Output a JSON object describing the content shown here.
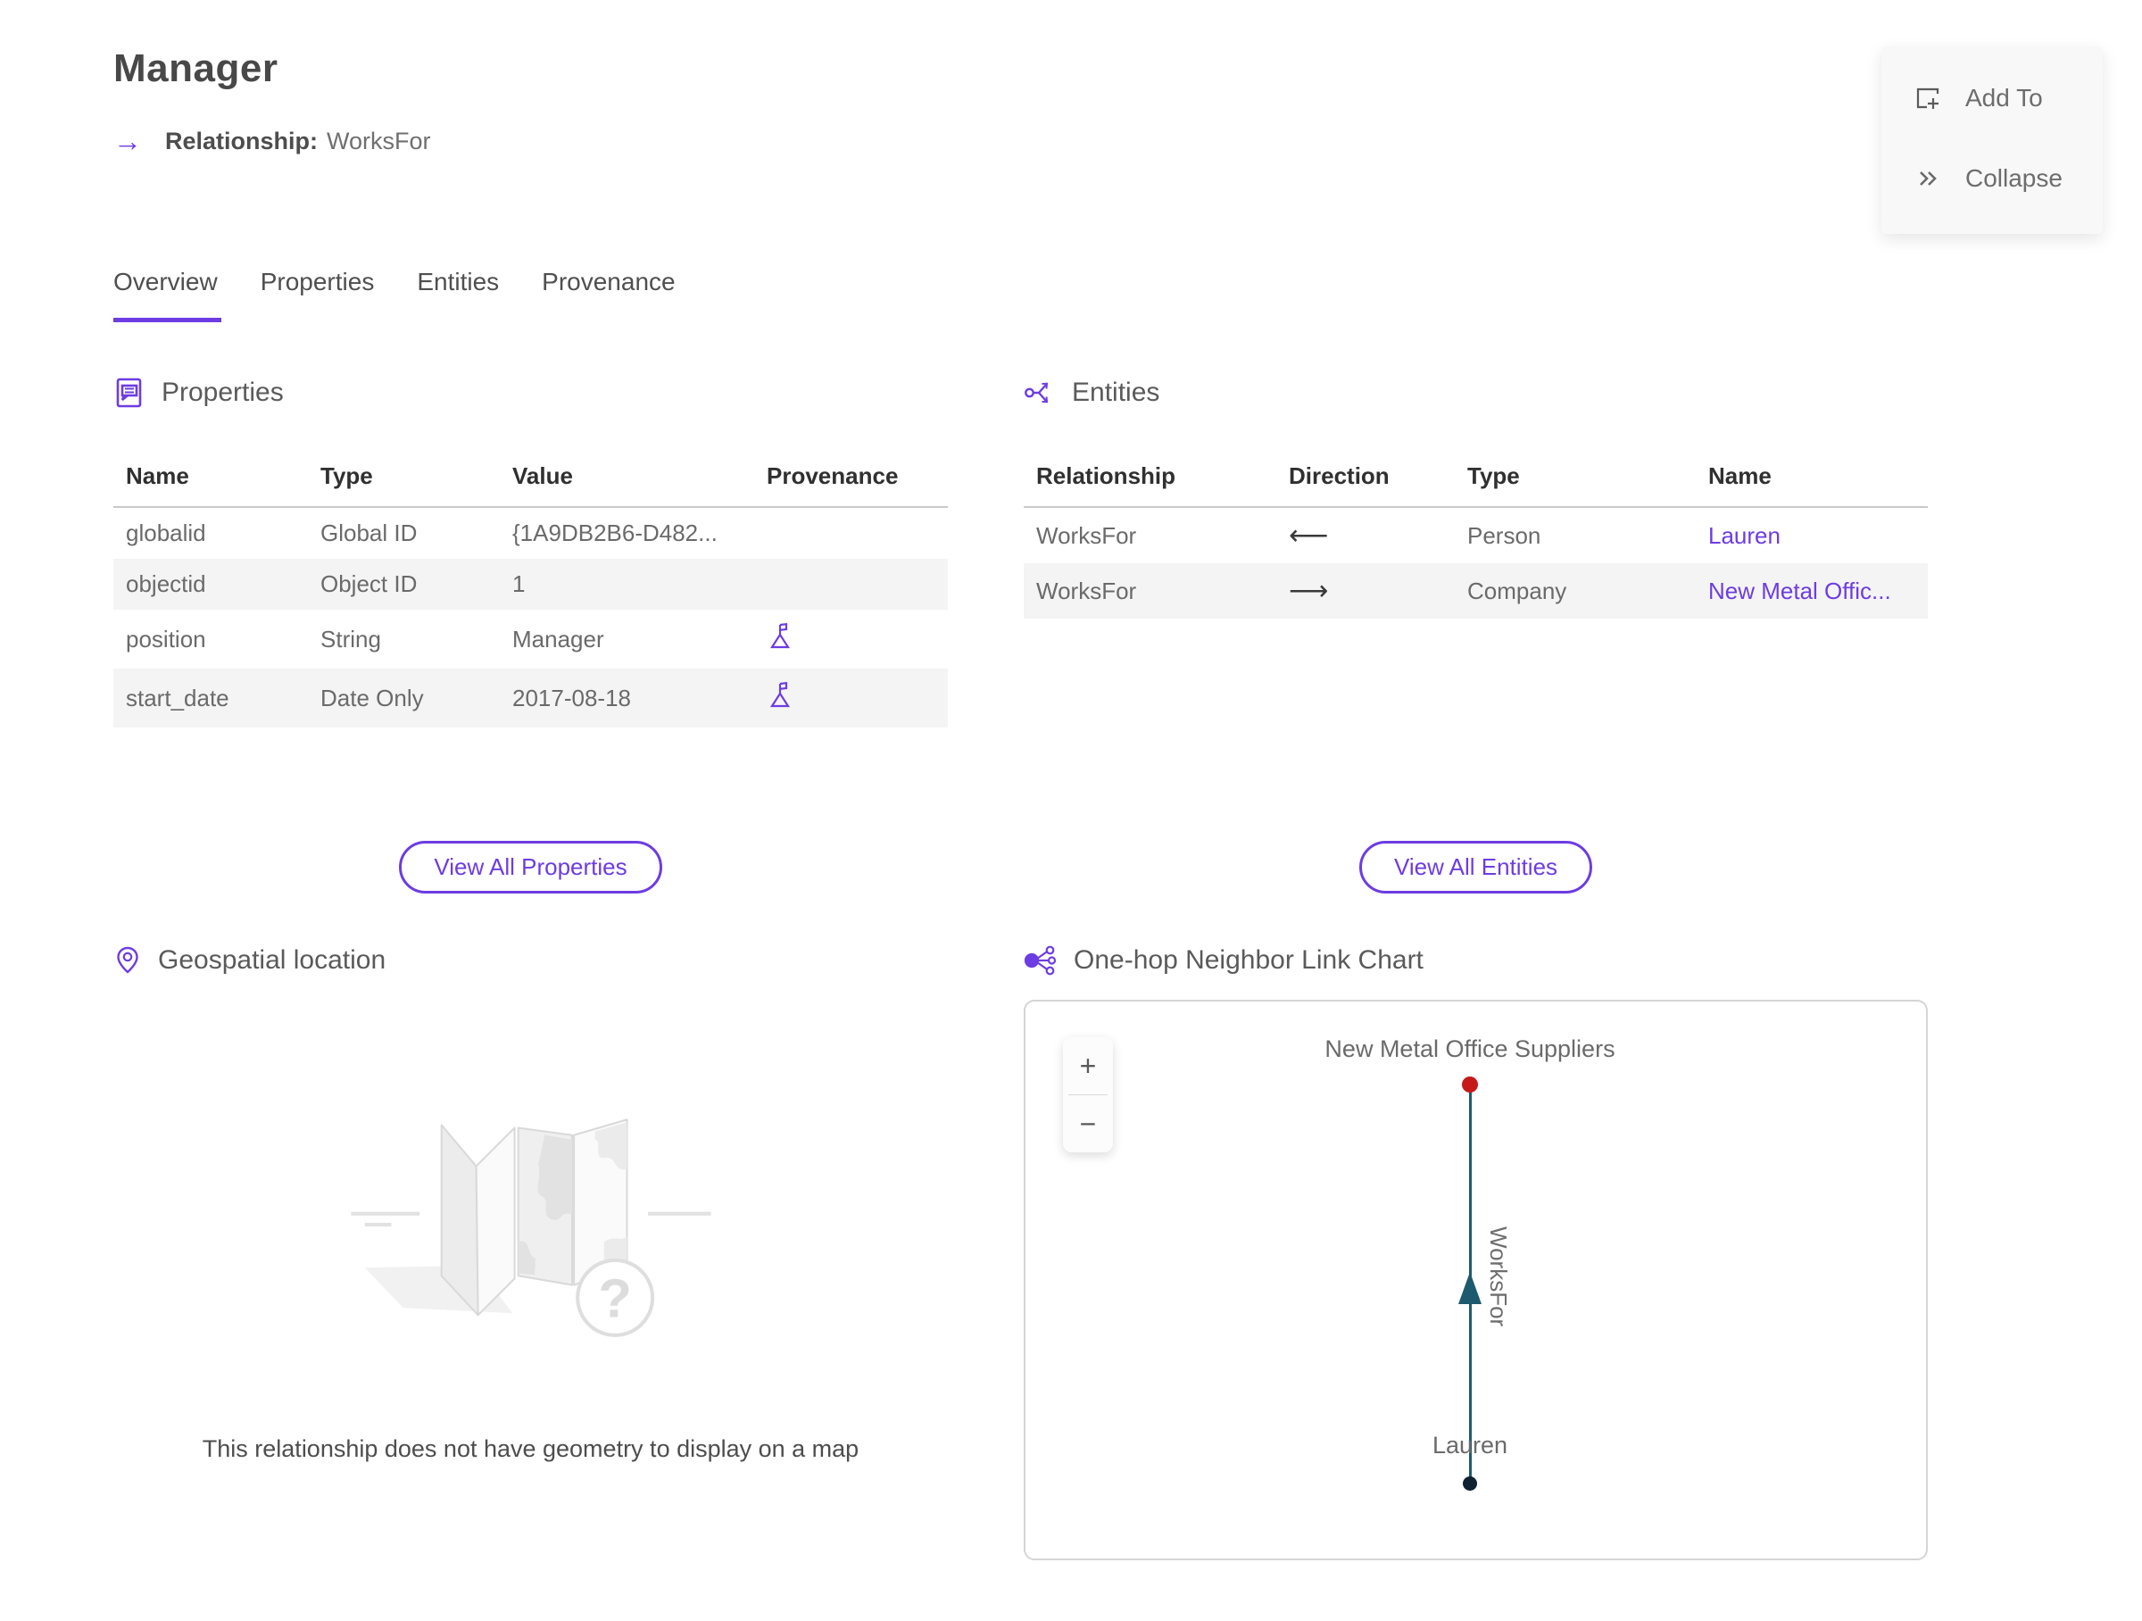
{
  "page": {
    "title": "Manager",
    "relationship_label": "Relationship:",
    "relationship_value": "WorksFor"
  },
  "actions": {
    "add_to": "Add To",
    "collapse": "Collapse"
  },
  "tabs": [
    {
      "label": "Overview"
    },
    {
      "label": "Properties"
    },
    {
      "label": "Entities"
    },
    {
      "label": "Provenance"
    }
  ],
  "active_tab": "Overview",
  "properties_section": {
    "heading": "Properties",
    "columns": [
      "Name",
      "Type",
      "Value",
      "Provenance"
    ],
    "rows": [
      {
        "name": "globalid",
        "type": "Global ID",
        "value": "{1A9DB2B6-D482...",
        "has_provenance": false
      },
      {
        "name": "objectid",
        "type": "Object ID",
        "value": "1",
        "has_provenance": false
      },
      {
        "name": "position",
        "type": "String",
        "value": "Manager",
        "has_provenance": true
      },
      {
        "name": "start_date",
        "type": "Date Only",
        "value": "2017-08-18",
        "has_provenance": true
      }
    ],
    "view_all": "View All Properties"
  },
  "entities_section": {
    "heading": "Entities",
    "columns": [
      "Relationship",
      "Direction",
      "Type",
      "Name"
    ],
    "rows": [
      {
        "relationship": "WorksFor",
        "direction": "⟵",
        "type": "Person",
        "name": "Lauren"
      },
      {
        "relationship": "WorksFor",
        "direction": "⟶",
        "type": "Company",
        "name": "New Metal Offic..."
      }
    ],
    "view_all": "View All Entities"
  },
  "geospatial_section": {
    "heading": "Geospatial location",
    "empty_message": "This relationship does not have geometry to display on a map"
  },
  "link_chart_section": {
    "heading": "One-hop Neighbor Link Chart",
    "zoom_in_label": "+",
    "zoom_out_label": "−",
    "edge_label": "WorksFor",
    "nodes": [
      {
        "label": "New Metal Office Suppliers",
        "color": "#c61a1a"
      },
      {
        "label": "Lauren",
        "color": "#0e2231"
      }
    ]
  },
  "colors": {
    "accent": "#6d3ce3",
    "edge_line": "#1d5a6e",
    "node_top": "#c61a1a",
    "node_bottom": "#0e2231",
    "row_alt": "#f4f4f4"
  }
}
